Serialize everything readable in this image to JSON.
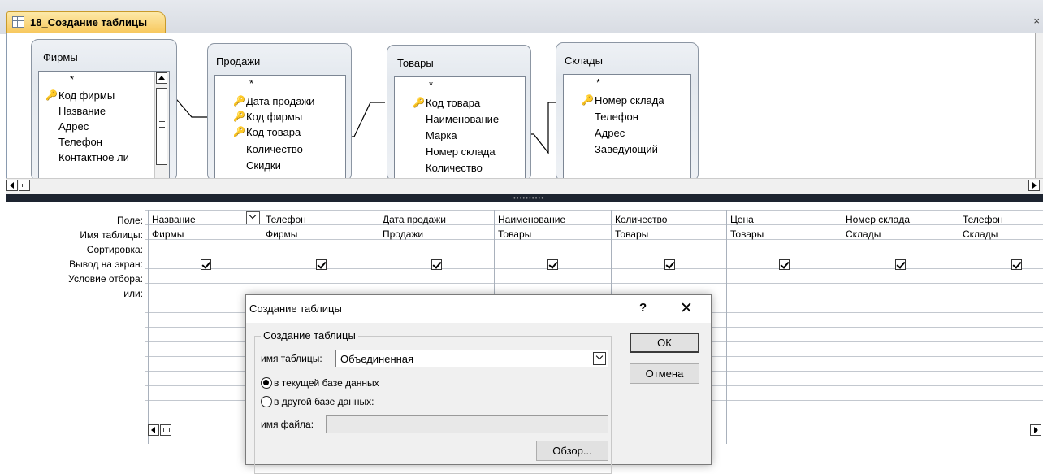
{
  "tab": {
    "title": "18_Создание таблицы",
    "close_glyph": "×"
  },
  "tables": [
    {
      "name": "Фирмы",
      "fields": [
        {
          "name": "*",
          "key": false
        },
        {
          "name": "Код фирмы",
          "key": true
        },
        {
          "name": "Название",
          "key": false
        },
        {
          "name": "Адрес",
          "key": false
        },
        {
          "name": "Телефон",
          "key": false
        },
        {
          "name": "Контактное ли",
          "key": false
        }
      ]
    },
    {
      "name": "Продажи",
      "fields": [
        {
          "name": "*",
          "key": false
        },
        {
          "name": "Дата продажи",
          "key": true
        },
        {
          "name": "Код фирмы",
          "key": true
        },
        {
          "name": "Код товара",
          "key": true
        },
        {
          "name": "Количество",
          "key": false
        },
        {
          "name": "Скидки",
          "key": false
        }
      ]
    },
    {
      "name": "Товары",
      "fields": [
        {
          "name": "*",
          "key": false
        },
        {
          "name": "Код товара",
          "key": true
        },
        {
          "name": "Наименование",
          "key": false
        },
        {
          "name": "Марка",
          "key": false
        },
        {
          "name": "Номер склада",
          "key": false
        },
        {
          "name": "Количество",
          "key": false
        }
      ]
    },
    {
      "name": "Склады",
      "fields": [
        {
          "name": "*",
          "key": false
        },
        {
          "name": "Номер склада",
          "key": true
        },
        {
          "name": "Телефон",
          "key": false
        },
        {
          "name": "Адрес",
          "key": false
        },
        {
          "name": "Заведующий",
          "key": false
        }
      ]
    }
  ],
  "grid": {
    "row_labels": {
      "field": "Поле:",
      "table": "Имя таблицы:",
      "sort": "Сортировка:",
      "show": "Вывод на экран:",
      "criteria": "Условие отбора:",
      "or": "или:"
    },
    "columns": [
      {
        "field": "Название",
        "table": "Фирмы",
        "show": true
      },
      {
        "field": "Телефон",
        "table": "Фирмы",
        "show": true
      },
      {
        "field": "Дата продажи",
        "table": "Продажи",
        "show": true
      },
      {
        "field": "Наименование",
        "table": "Товары",
        "show": true
      },
      {
        "field": "Количество",
        "table": "Товары",
        "show": true
      },
      {
        "field": "Цена",
        "table": "Товары",
        "show": true
      },
      {
        "field": "Номер склада",
        "table": "Склады",
        "show": true
      },
      {
        "field": "Телефон",
        "table": "Склады",
        "show": true
      }
    ]
  },
  "dialog": {
    "title": "Создание таблицы",
    "help_glyph": "?",
    "close_glyph": "✕",
    "group_title": "Создание таблицы",
    "table_name_label": "имя таблицы:",
    "table_name_value": "Объединенная",
    "radio_current": "в текущей базе данных",
    "radio_other": "в другой базе данных:",
    "selected": "current",
    "file_name_label": "имя файла:",
    "file_name_value": "",
    "ok_label": "ОК",
    "cancel_label": "Отмена",
    "browse_label": "Обзор..."
  }
}
